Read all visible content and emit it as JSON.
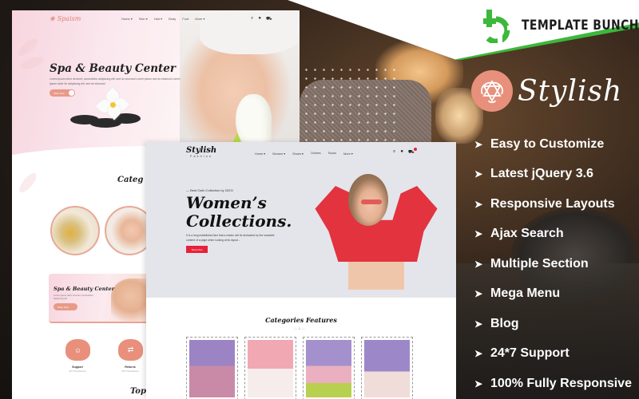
{
  "brand": {
    "name": "TEMPLATE BUNCH",
    "logo_icon": "template-bunch-logo-icon",
    "accent_color": "#3cb83a"
  },
  "product": {
    "name": "Stylish",
    "badge_icon": "lotus-badge-icon",
    "badge_color": "#e8907c"
  },
  "features": [
    {
      "label": "Easy to Customize",
      "icon": "arrow-right-icon"
    },
    {
      "label": "Latest jQuery 3.6",
      "icon": "arrow-right-icon"
    },
    {
      "label": "Responsive Layouts",
      "icon": "arrow-right-icon"
    },
    {
      "label": "Ajax Search",
      "icon": "arrow-right-icon"
    },
    {
      "label": "Multiple Section",
      "icon": "arrow-right-icon"
    },
    {
      "label": "Mega Menu",
      "icon": "arrow-right-icon"
    },
    {
      "label": "Blog",
      "icon": "arrow-right-icon"
    },
    {
      "label": "24*7 Support",
      "icon": "arrow-right-icon"
    },
    {
      "label": "100% Fully Responsive",
      "icon": "arrow-right-icon"
    }
  ],
  "spa_preview": {
    "logo": "Spaism",
    "menu": [
      "Home ▾",
      "Skin ▾",
      "Hair ▾",
      "Body",
      "Foot",
      "More ▾"
    ],
    "icons": [
      "search-icon",
      "user-icon",
      "cart-icon"
    ],
    "hero_title": "Spa & Beauty Center",
    "hero_desc": "Lorem ipsum dolor sit amet, consectetur adipiscing elit, sed do eiusmod Lorem ipsum sed do eiusmod Lorem ipsum dolor for adipiscing elit, sed do eiusmod",
    "hero_button": "Shop Now",
    "section_title": "Categ",
    "banner_title": "Spa & Beauty Center",
    "banner_desc": "Lorem ipsum dolor sit amet, consectetur adipiscing elit",
    "banner_button": "Shop Now",
    "services": [
      {
        "label": "Support",
        "sub": "24*7 Free Returns",
        "icon": "support-agent-icon"
      },
      {
        "label": "Returns",
        "sub": "24*7 Free Returns",
        "icon": "return-arrows-icon"
      }
    ],
    "bottom_title": "Top"
  },
  "fashion_preview": {
    "logo_main": "Stylish",
    "logo_sub": "Fashion",
    "menu": [
      "Home ▾",
      "Women ▾",
      "Shoes ▾",
      "Clothes",
      "Socks",
      "More ▾"
    ],
    "icons": [
      "search-icon",
      "user-icon",
      "cart-icon"
    ],
    "kicker": "— Best Cloth Collection by 2023!",
    "hero_title_line1": "Women’s",
    "hero_title_line2": "Collections.",
    "hero_desc": "It is a long established fact that a reader will be distracted by the readable content of a page when looking at its layout...",
    "hero_button": "Shop Now",
    "accent_color": "#e8203a",
    "section_title": "Categories Features",
    "section_ornament": "— ♙ —",
    "cards": [
      {
        "name": "category-card-pink-coat",
        "bg": "#9c84c4"
      },
      {
        "name": "category-card-black-hat",
        "bg": "#f2a8b2"
      },
      {
        "name": "category-card-pink-beret",
        "bg": "#a490cc"
      },
      {
        "name": "category-card-flower-crown",
        "bg": "#9c88c8"
      }
    ]
  }
}
